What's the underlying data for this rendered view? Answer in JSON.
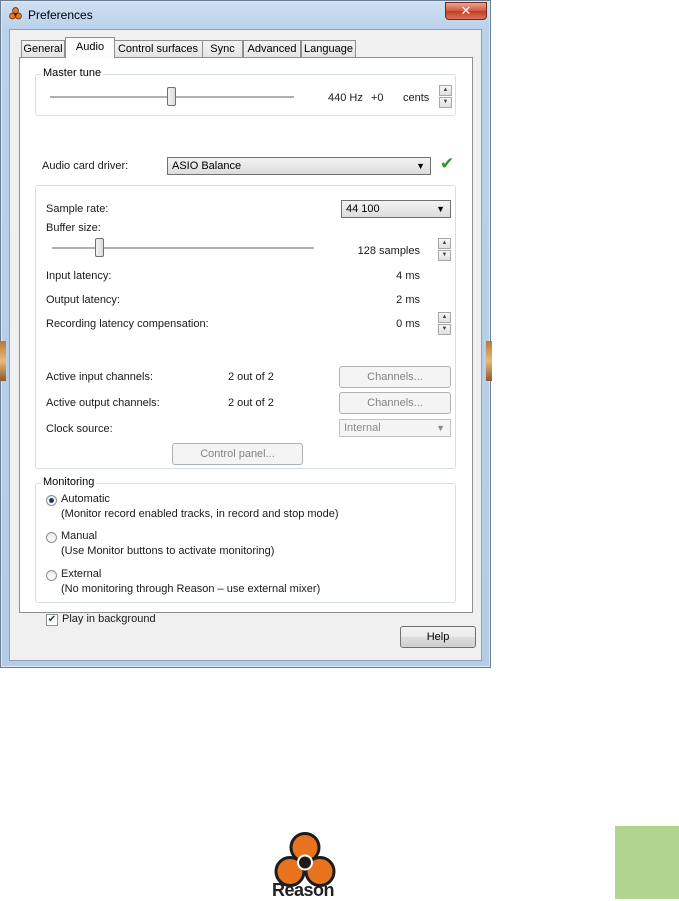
{
  "window": {
    "title": "Preferences",
    "close_glyph": "✕"
  },
  "tabs": [
    {
      "label": "General"
    },
    {
      "label": "Audio"
    },
    {
      "label": "Control surfaces"
    },
    {
      "label": "Sync"
    },
    {
      "label": "Advanced"
    },
    {
      "label": "Language"
    }
  ],
  "master_tune": {
    "label": "Master tune",
    "hz": "440 Hz",
    "cents_value": "+0",
    "cents_unit": "cents"
  },
  "audio_card": {
    "label": "Audio card driver:",
    "selected": "ASIO Balance",
    "status_icon": "green-check-icon"
  },
  "settings": {
    "sample_rate_label": "Sample rate:",
    "sample_rate_value": "44 100",
    "buffer_size_label": "Buffer size:",
    "buffer_size_value": "128 samples",
    "input_latency_label": "Input latency:",
    "input_latency_value": "4 ms",
    "output_latency_label": "Output latency:",
    "output_latency_value": "2 ms",
    "recording_comp_label": "Recording latency compensation:",
    "recording_comp_value": "0 ms",
    "active_input_label": "Active input channels:",
    "active_input_value": "2 out of 2",
    "active_output_label": "Active output channels:",
    "active_output_value": "2 out of 2",
    "channels_button": "Channels...",
    "clock_source_label": "Clock source:",
    "clock_source_value": "Internal",
    "control_panel_button": "Control panel..."
  },
  "monitoring": {
    "label": "Monitoring",
    "options": [
      {
        "label": "Automatic",
        "desc": "(Monitor record enabled tracks, in record and stop mode)",
        "checked": true
      },
      {
        "label": "Manual",
        "desc": "(Use Monitor buttons to activate monitoring)",
        "checked": false
      },
      {
        "label": "External",
        "desc": "(No monitoring through Reason – use external mixer)",
        "checked": false
      }
    ]
  },
  "play_in_background": {
    "label": "Play in background",
    "checked": true,
    "check_glyph": "✔"
  },
  "help_button": "Help",
  "branding": {
    "logo_text": "Reason"
  },
  "colors": {
    "accent_green": "#2e9b2e",
    "page_tab_green": "#b1d48e",
    "logo_orange": "#e8731f"
  }
}
